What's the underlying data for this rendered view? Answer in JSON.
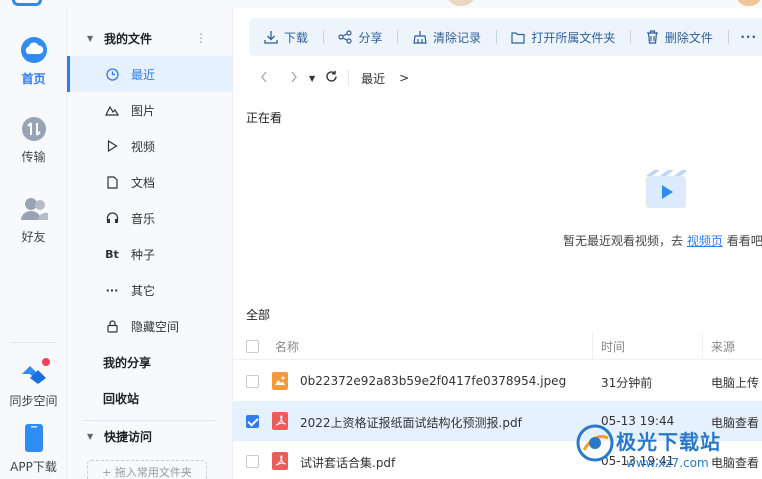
{
  "rail": {
    "items": [
      {
        "label": "首页"
      },
      {
        "label": "传输"
      },
      {
        "label": "好友"
      },
      {
        "label": "同步空间"
      },
      {
        "label": "APP下载"
      }
    ]
  },
  "sidebar": {
    "my_files": "我的文件",
    "items": [
      {
        "label": "最近",
        "icon": "clock-icon"
      },
      {
        "label": "图片",
        "icon": "mountain-icon"
      },
      {
        "label": "视频",
        "icon": "play-icon"
      },
      {
        "label": "文档",
        "icon": "document-icon"
      },
      {
        "label": "音乐",
        "icon": "headphones-icon"
      },
      {
        "label": "种子",
        "icon": "bt-icon",
        "glyph": "Bt"
      },
      {
        "label": "其它",
        "icon": "ellipsis-icon",
        "glyph": "···"
      },
      {
        "label": "隐藏空间",
        "icon": "lock-icon"
      }
    ],
    "my_share": "我的分享",
    "recycle": "回收站",
    "quick_access": "快捷访问",
    "quick_add": "+ 拖入常用文件夹"
  },
  "toolbar": {
    "download": "下载",
    "share": "分享",
    "clear": "清除记录",
    "open_folder": "打开所属文件夹",
    "delete": "删除文件",
    "more": "···"
  },
  "nav": {
    "crumb": "最近",
    "crumb_sep": ">"
  },
  "watching": {
    "title": "正在看",
    "empty_prefix": "暂无最近观看视频，去",
    "empty_link": "视频页",
    "empty_suffix": "看看吧"
  },
  "all": {
    "title": "全部",
    "columns": {
      "name": "名称",
      "time": "时间",
      "source": "来源"
    },
    "rows": [
      {
        "name": "0b22372e92a83b59e2f0417fe0378954.jpeg",
        "time": "31分钟前",
        "source": "电脑上传",
        "type": "img",
        "checked": false
      },
      {
        "name": "2022上资格证报纸面试结构化预测报.pdf",
        "time": "05-13 19:44",
        "source": "电脑查看",
        "type": "pdf",
        "checked": true
      },
      {
        "name": "试讲套话合集.pdf",
        "time": "05-13 19:41",
        "source": "电脑查看",
        "type": "pdf",
        "checked": false
      }
    ]
  },
  "watermark": {
    "title": "极光下载站",
    "sub": "www.xz7.com"
  },
  "colors": {
    "accent": "#2f7bf4",
    "selected_bg": "#e6f1ff",
    "toolbar_bg": "#eef4fc",
    "pdf": "#ef5b5b",
    "image": "#f59a3c"
  }
}
